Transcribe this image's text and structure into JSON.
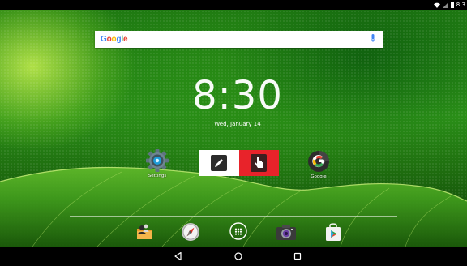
{
  "status_bar": {
    "time": "8:3",
    "icons": [
      "wifi-icon",
      "signal-icon",
      "battery-icon"
    ]
  },
  "search": {
    "logo": [
      "G",
      "o",
      "o",
      "g",
      "l",
      "e"
    ],
    "logo_colors": [
      "#4285f4",
      "#ea4335",
      "#fbbc05",
      "#4285f4",
      "#34a853",
      "#ea4335"
    ],
    "mic_icon": "mic-icon"
  },
  "clock": {
    "time": "8:30",
    "date": "Wed, January 14"
  },
  "home_apps": [
    {
      "label": "Settings",
      "icon": "settings-gear-icon"
    },
    {
      "label": "Google",
      "icon": "google-app-icon"
    }
  ],
  "widget": {
    "left_icon": "pen-icon",
    "right_icon": "hand-pointer-icon",
    "left_color": "#ffffff",
    "right_color": "#e8232a"
  },
  "dock": [
    {
      "icon": "contacts-folder-icon"
    },
    {
      "icon": "compass-browser-icon"
    },
    {
      "icon": "app-drawer-icon"
    },
    {
      "icon": "camera-icon"
    },
    {
      "icon": "play-store-icon"
    }
  ],
  "nav": {
    "back": "back-icon",
    "home": "home-icon",
    "recents": "recents-icon"
  }
}
